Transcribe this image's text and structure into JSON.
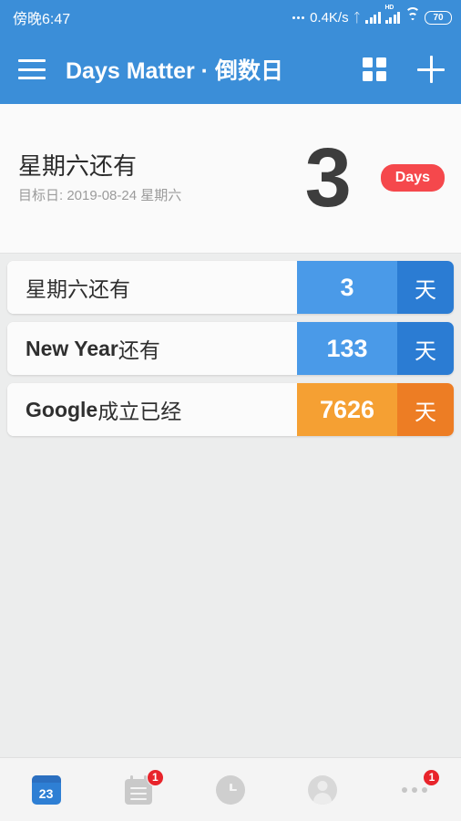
{
  "status_bar": {
    "clock": "傍晚6:47",
    "network_speed": "0.4K/s",
    "bluetooth_icon": "bluetooth-icon",
    "hd_label": "HD",
    "battery_level": "70"
  },
  "app_bar": {
    "menu_icon": "hamburger-menu-icon",
    "title": "Days Matter · 倒数日",
    "grid_icon": "grid-view-icon",
    "add_icon": "plus-add-icon"
  },
  "header_card": {
    "title": "星期六还有",
    "subtitle": "目标日: 2019-08-24 星期六",
    "count": "3",
    "badge": "Days",
    "badge_color": "#f5484c"
  },
  "events": [
    {
      "label_en": "",
      "label_cn": "星期六还有",
      "count": "3",
      "unit": "天",
      "count_color": "#4a9ae8",
      "unit_color": "#2b7cd3"
    },
    {
      "label_en": "New Year",
      "label_cn": " 还有",
      "count": "133",
      "unit": "天",
      "count_color": "#4a9ae8",
      "unit_color": "#2b7cd3"
    },
    {
      "label_en": "Google",
      "label_cn": " 成立已经",
      "count": "7626",
      "unit": "天",
      "count_color": "#f5a033",
      "unit_color": "#ed7d24"
    }
  ],
  "bottom_nav": [
    {
      "icon": "calendar-icon",
      "day_number": "23",
      "badge": ""
    },
    {
      "icon": "notes-icon",
      "badge": "1"
    },
    {
      "icon": "clock-icon",
      "badge": ""
    },
    {
      "icon": "profile-icon",
      "badge": ""
    },
    {
      "icon": "more-dots-icon",
      "badge": "1"
    }
  ],
  "theme": {
    "primary": "#3b8ed8",
    "background": "#eceded"
  }
}
